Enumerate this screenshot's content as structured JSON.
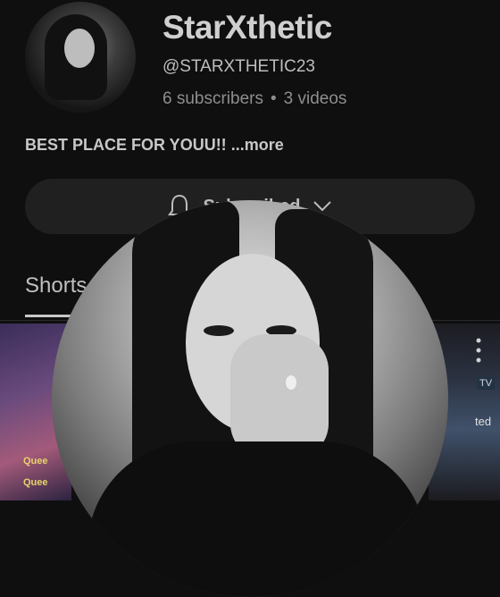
{
  "channel": {
    "name": "StarXthetic",
    "handle": "@STARXTHETIC23",
    "subscribers": "6 subscribers",
    "separator": "•",
    "videos": "3 videos",
    "description": "BEST PLACE FOR YOUU!!",
    "more_label": "...more"
  },
  "subscribe_button": {
    "label": "Subscribed"
  },
  "tabs": {
    "active": "Shorts"
  },
  "thumbnails": {
    "left_label_1": "Quee",
    "left_label_2": "Quee",
    "right_badge": "TV",
    "right_text": "ted"
  },
  "colors": {
    "background": "#0f0f0f",
    "button_bg": "#202020",
    "text_primary": "#cfcfcf",
    "text_secondary": "#8e8e8e"
  },
  "icons": {
    "bell": "bell-icon",
    "chevron": "chevron-down-icon",
    "more": "more-vertical-icon"
  }
}
